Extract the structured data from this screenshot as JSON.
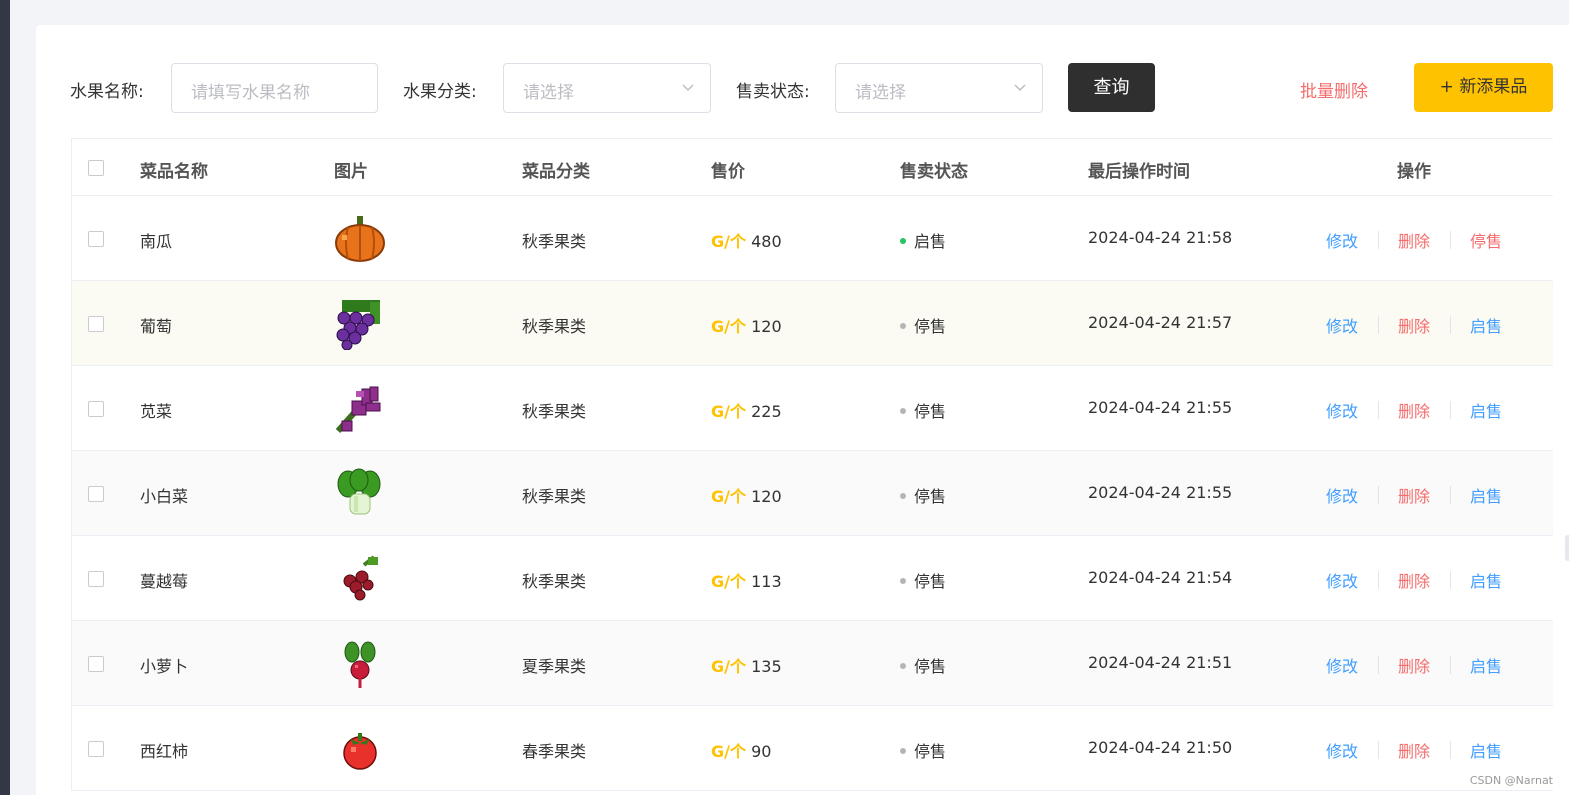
{
  "filters": {
    "name_label": "水果名称:",
    "name_placeholder": "请填写水果名称",
    "category_label": "水果分类:",
    "category_placeholder": "请选择",
    "status_label": "售卖状态:",
    "status_placeholder": "请选择",
    "query_label": "查询",
    "batch_delete_label": "批量删除",
    "add_label": "+ 新添果品"
  },
  "table": {
    "headers": {
      "name": "菜品名称",
      "image": "图片",
      "category": "菜品分类",
      "price": "售价",
      "status": "售卖状态",
      "updated": "最后操作时间",
      "actions": "操作"
    },
    "rows": [
      {
        "name": "南瓜",
        "category": "秋季果类",
        "price_unit": "G/个",
        "price": "480",
        "status": "启售",
        "updated": "2024-04-24 21:58",
        "edit": "修改",
        "delete": "删除",
        "toggle": "停售",
        "image_icon": "pumpkin-icon"
      },
      {
        "name": "葡萄",
        "category": "秋季果类",
        "price_unit": "G/个",
        "price": "120",
        "status": "停售",
        "updated": "2024-04-24 21:57",
        "edit": "修改",
        "delete": "删除",
        "toggle": "启售",
        "image_icon": "grape-icon"
      },
      {
        "name": "苋菜",
        "category": "秋季果类",
        "price_unit": "G/个",
        "price": "225",
        "status": "停售",
        "updated": "2024-04-24 21:55",
        "edit": "修改",
        "delete": "删除",
        "toggle": "启售",
        "image_icon": "amaranth-icon"
      },
      {
        "name": "小白菜",
        "category": "秋季果类",
        "price_unit": "G/个",
        "price": "120",
        "status": "停售",
        "updated": "2024-04-24 21:55",
        "edit": "修改",
        "delete": "删除",
        "toggle": "启售",
        "image_icon": "bok-choy-icon"
      },
      {
        "name": "蔓越莓",
        "category": "秋季果类",
        "price_unit": "G/个",
        "price": "113",
        "status": "停售",
        "updated": "2024-04-24 21:54",
        "edit": "修改",
        "delete": "删除",
        "toggle": "启售",
        "image_icon": "cranberry-icon"
      },
      {
        "name": "小萝卜",
        "category": "夏季果类",
        "price_unit": "G/个",
        "price": "135",
        "status": "停售",
        "updated": "2024-04-24 21:51",
        "edit": "修改",
        "delete": "删除",
        "toggle": "启售",
        "image_icon": "radish-icon"
      },
      {
        "name": "西红柿",
        "category": "春季果类",
        "price_unit": "G/个",
        "price": "90",
        "status": "停售",
        "updated": "2024-04-24 21:50",
        "edit": "修改",
        "delete": "删除",
        "toggle": "启售",
        "image_icon": "tomato-icon"
      }
    ]
  },
  "colors": {
    "accent": "#ffc200",
    "dark_button": "#2f2f2f",
    "link_blue": "#419eff",
    "danger_red": "#f56c6c",
    "status_on": "#22c55e",
    "status_off": "#b5b5b5"
  },
  "watermark": "CSDN @Narnat"
}
